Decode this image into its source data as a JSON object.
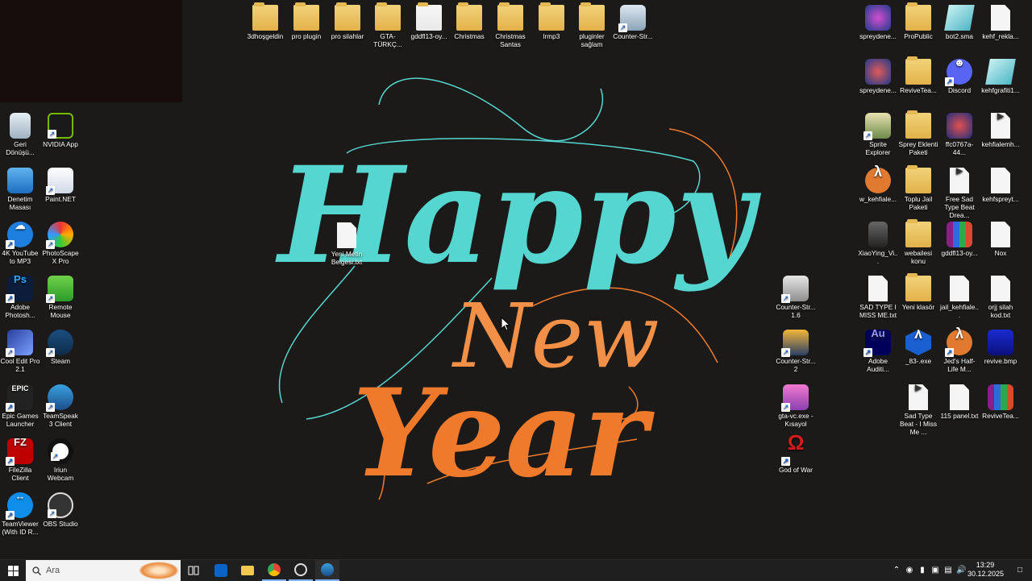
{
  "wallpaper": {
    "line1": "Happy",
    "line2": "New",
    "line3": "Year"
  },
  "icons_top": [
    {
      "label": "3dhoşgeldin",
      "type": "folder"
    },
    {
      "label": "pro plugin",
      "type": "folder"
    },
    {
      "label": "pro silahlar",
      "type": "folder"
    },
    {
      "label": "GTA-TÜRKÇ...",
      "type": "folder"
    },
    {
      "label": "gddfl13-oy...",
      "type": "folder"
    },
    {
      "label": "Christmas",
      "type": "folder"
    },
    {
      "label": "Christmas Santas",
      "type": "folder"
    },
    {
      "label": "lrmp3",
      "type": "folder"
    },
    {
      "label": "pluginler sağlam",
      "type": "folder"
    },
    {
      "label": "Counter-Str...",
      "type": "app"
    }
  ],
  "icons_left_col1": [
    {
      "label": "Geri Dönüşü...",
      "icon": "recycle-bin-icon"
    },
    {
      "label": "Denetim Masası",
      "icon": "control-panel-icon"
    },
    {
      "label": "4K YouTube to MP3",
      "icon": "4k-youtube-icon"
    },
    {
      "label": "Adobe Photosh...",
      "icon": "photoshop-icon"
    },
    {
      "label": "Cool Edit Pro 2.1",
      "icon": "cool-edit-icon"
    },
    {
      "label": "Epic Games Launcher",
      "icon": "epic-games-icon"
    },
    {
      "label": "FileZilla Client",
      "icon": "filezilla-icon"
    },
    {
      "label": "TeamViewer (With ID R...",
      "icon": "teamviewer-icon"
    }
  ],
  "icons_left_col2": [
    {
      "label": "NVIDIA App",
      "icon": "nvidia-icon"
    },
    {
      "label": "Paint.NET",
      "icon": "paint-net-icon"
    },
    {
      "label": "PhotoScape X Pro",
      "icon": "photoscape-icon"
    },
    {
      "label": "Remote Mouse",
      "icon": "remote-mouse-icon"
    },
    {
      "label": "Steam",
      "icon": "steam-icon"
    },
    {
      "label": "TeamSpeak 3 Client",
      "icon": "teamspeak-icon"
    },
    {
      "label": "Iriun Webcam",
      "icon": "iriun-webcam-icon"
    },
    {
      "label": "OBS Studio",
      "icon": "obs-icon"
    }
  ],
  "icon_center": {
    "label": "Yeni Metin Belgesi.txt",
    "icon": "text-file-icon"
  },
  "icons_mid_right": [
    {
      "label": "Counter-Str... 1.6",
      "icon": "counter-strike-icon"
    },
    {
      "label": "Counter-Str... 2",
      "icon": "counter-strike-2-icon"
    },
    {
      "label": "gta-vc.exe - Kısayol",
      "icon": "gta-vc-icon"
    },
    {
      "label": "God of War",
      "icon": "god-of-war-icon"
    }
  ],
  "icons_right": [
    [
      {
        "label": "spreydene...",
        "icon": "spray-image-icon"
      },
      {
        "label": "spreydene...",
        "icon": "spray-image-icon"
      },
      {
        "label": "Sprite Explorer",
        "icon": "sprite-explorer-icon"
      },
      {
        "label": "w_kehfiale...",
        "icon": "half-life-icon"
      },
      {
        "label": "XiaoYing_Vi...",
        "icon": "video-thumb-icon"
      },
      {
        "label": "SAD TYPE I MISS ME.txt",
        "icon": "text-file-icon"
      },
      {
        "label": "Adobe Auditi...",
        "icon": "audition-icon"
      }
    ],
    [
      {
        "label": "ProPublic",
        "icon": "folder-icon"
      },
      {
        "label": "ReviveTea...",
        "icon": "folder-icon"
      },
      {
        "label": "Sprey Eklenti Paketi",
        "icon": "folder-icon"
      },
      {
        "label": "Toplu Jail Paketi",
        "icon": "folder-icon"
      },
      {
        "label": "webailesi konu",
        "icon": "folder-icon"
      },
      {
        "label": "Yeni klasör",
        "icon": "folder-icon"
      },
      {
        "label": "_83-.exe",
        "icon": "half-life-exe-icon"
      },
      {
        "label": "Sad Type Beat - I Miss Me ...",
        "icon": "media-file-icon"
      }
    ],
    [
      {
        "label": "bot2.sma",
        "icon": "sma-file-icon"
      },
      {
        "label": "Discord",
        "icon": "discord-icon"
      },
      {
        "label": "ffc0767a-44...",
        "icon": "image-file-icon"
      },
      {
        "label": "Free Sad Type Beat Drea...",
        "icon": "media-file-icon"
      },
      {
        "label": "gddfl13-oy...",
        "icon": "rar-archive-icon"
      },
      {
        "label": "jail_kehfiale...",
        "icon": "text-file-icon"
      },
      {
        "label": "Jed's Half-Life M...",
        "icon": "half-life-icon"
      },
      {
        "label": "115 panel.txt",
        "icon": "text-file-icon"
      }
    ],
    [
      {
        "label": "kehf_rekla...",
        "icon": "tga-file-icon"
      },
      {
        "label": "kehfgrafiti1...",
        "icon": "sma-file-icon"
      },
      {
        "label": "kehfialemh...",
        "icon": "media-file-icon"
      },
      {
        "label": "kehfspreyt...",
        "icon": "text-file-icon"
      },
      {
        "label": "Nox",
        "icon": "text-file-icon"
      },
      {
        "label": "orjj silah kod.txt",
        "icon": "text-file-icon"
      },
      {
        "label": "revive.bmp",
        "icon": "bmp-file-icon"
      },
      {
        "label": "ReviveTea...",
        "icon": "rar-archive-icon"
      }
    ]
  ],
  "taskbar": {
    "search_placeholder": "Ara",
    "time": "13:29",
    "date": "30.12.2025"
  },
  "colors": {
    "teal": "#56d6d0",
    "orange": "#f07a2c",
    "taskbar": "#1f1f1f"
  }
}
